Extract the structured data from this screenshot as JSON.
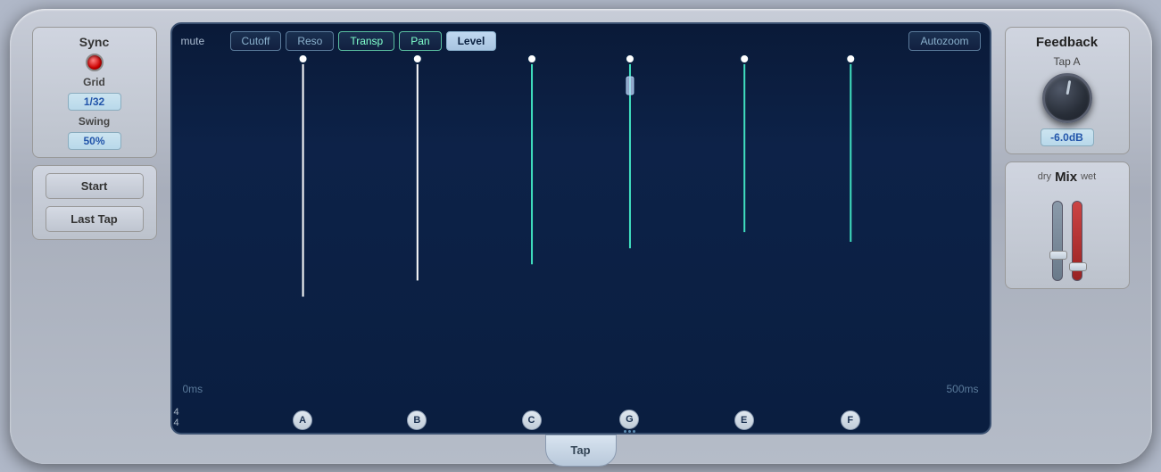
{
  "left": {
    "sync_label": "Sync",
    "grid_label": "Grid",
    "grid_value": "1/32",
    "swing_label": "Swing",
    "swing_value": "50%",
    "start_label": "Start",
    "last_tap_label": "Last Tap",
    "time_sig_top": "4",
    "time_sig_bot": "4"
  },
  "tabs": {
    "mute_label": "mute",
    "cutoff_label": "Cutoff",
    "reso_label": "Reso",
    "transp_label": "Transp",
    "pan_label": "Pan",
    "level_label": "Level",
    "autozoom_label": "Autozoom"
  },
  "grid": {
    "time_start": "0ms",
    "time_end": "500ms"
  },
  "taps": [
    {
      "id": "A",
      "x_pct": 16,
      "height_pct": 75,
      "color": "white"
    },
    {
      "id": "B",
      "x_pct": 30,
      "height_pct": 68,
      "color": "white"
    },
    {
      "id": "C",
      "x_pct": 44,
      "height_pct": 60,
      "color": "cyan"
    },
    {
      "id": "G",
      "x_pct": 56,
      "height_pct": 57,
      "color": "cyan"
    },
    {
      "id": "E",
      "x_pct": 70,
      "height_pct": 52,
      "color": "cyan"
    },
    {
      "id": "F",
      "x_pct": 83,
      "height_pct": 55,
      "color": "cyan"
    }
  ],
  "tap_button": {
    "label": "Tap"
  },
  "right": {
    "feedback_label": "Feedback",
    "tap_a_label": "Tap A",
    "db_label": "-6.0dB",
    "mix_label": "Mix",
    "dry_label": "dry",
    "wet_label": "wet"
  }
}
